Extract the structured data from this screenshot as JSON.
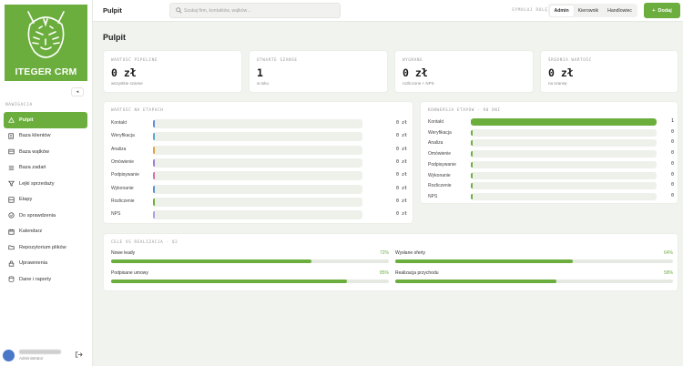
{
  "sidebar": {
    "logo_text": "ITEGER CRM",
    "collapse_glyph": "◂",
    "section_label": "NAWIGACJA",
    "items": [
      {
        "label": "Pulpit",
        "icon": "home-icon",
        "active": true
      },
      {
        "label": "Baza klientów",
        "icon": "contacts-icon"
      },
      {
        "label": "Baza wątków",
        "icon": "threads-icon"
      },
      {
        "label": "Baza zadań",
        "icon": "tasks-icon"
      },
      {
        "label": "Lejki sprzedaży",
        "icon": "funnel-icon"
      },
      {
        "label": "Etapy",
        "icon": "stages-icon"
      },
      {
        "label": "Do sprawdzenia",
        "icon": "check-icon"
      },
      {
        "label": "Kalendarz",
        "icon": "calendar-icon"
      },
      {
        "label": "Repozytorium plików",
        "icon": "folder-icon"
      },
      {
        "label": "Uprawnienia",
        "icon": "permissions-icon"
      },
      {
        "label": "Dane i raporty",
        "icon": "database-icon"
      }
    ],
    "user": {
      "role": "Administrator"
    }
  },
  "topbar": {
    "page_title": "Pulpit",
    "search_placeholder": "Szukaj firm, kontaktów, wątków…",
    "role_label": "SYMULUJ ROLĘ",
    "roles": [
      {
        "label": "Admin",
        "active": true
      },
      {
        "label": "Kierownik",
        "active": false
      },
      {
        "label": "Handlowiec",
        "active": false
      }
    ],
    "add_label": "Dodaj",
    "add_icon": "+"
  },
  "main": {
    "title": "Pulpit",
    "kpis": [
      {
        "label": "WARTOŚĆ PIPELINE",
        "value": "0 zł",
        "sub": "wszystkie szanse"
      },
      {
        "label": "OTWARTE SZANSE",
        "value": "1",
        "sub": "w toku"
      },
      {
        "label": "WYGRANE",
        "value": "0 zł",
        "sub": "rozliczone + NPS"
      },
      {
        "label": "ŚREDNIA WARTOŚĆ",
        "value": "0 zł",
        "sub": "na szansę"
      }
    ],
    "value_by_stage": {
      "label": "WARTOŚĆ NA ETAPACH",
      "rows": [
        {
          "label": "Kontakt",
          "value": "0 zł",
          "fraction": 0,
          "color": "#5b8fd6"
        },
        {
          "label": "Weryfikacja",
          "value": "0 zł",
          "fraction": 0,
          "color": "#5aa7c9"
        },
        {
          "label": "Analiza",
          "value": "0 zł",
          "fraction": 0,
          "color": "#e0a23c"
        },
        {
          "label": "Omówienie",
          "value": "0 zł",
          "fraction": 0,
          "color": "#9a7ed6"
        },
        {
          "label": "Podpisywanie",
          "value": "0 zł",
          "fraction": 0,
          "color": "#d66fa6"
        },
        {
          "label": "Wykonanie",
          "value": "0 zł",
          "fraction": 0,
          "color": "#5b8fd6"
        },
        {
          "label": "Rozliczenie",
          "value": "0 zł",
          "fraction": 0,
          "color": "#6cae3e"
        },
        {
          "label": "NPS",
          "value": "0 zł",
          "fraction": 0,
          "color": "#b29be0"
        }
      ]
    },
    "conversion": {
      "label": "KONWERSJA ETAPÓW · 90 DNI",
      "rows": [
        {
          "label": "Kontakt",
          "value": "1",
          "fraction": 1
        },
        {
          "label": "Weryfikacja",
          "value": "0",
          "fraction": 0
        },
        {
          "label": "Analiza",
          "value": "0",
          "fraction": 0
        },
        {
          "label": "Omówienie",
          "value": "0",
          "fraction": 0
        },
        {
          "label": "Podpisywanie",
          "value": "0",
          "fraction": 0
        },
        {
          "label": "Wykonanie",
          "value": "0",
          "fraction": 0
        },
        {
          "label": "Rozliczenie",
          "value": "0",
          "fraction": 0
        },
        {
          "label": "NPS",
          "value": "0",
          "fraction": 0
        }
      ]
    },
    "goals": {
      "label": "CELE VS REALIZACJA · Q2",
      "items": [
        {
          "label": "Nowe leady",
          "pct": "72%",
          "fraction": 0.72
        },
        {
          "label": "Wysłane oferty",
          "pct": "64%",
          "fraction": 0.64
        },
        {
          "label": "Podpisane umowy",
          "pct": "85%",
          "fraction": 0.85
        },
        {
          "label": "Realizacja przychodu",
          "pct": "58%",
          "fraction": 0.58
        }
      ]
    }
  },
  "colors": {
    "accent": "#6cae3e",
    "background": "#f1f3ee"
  }
}
